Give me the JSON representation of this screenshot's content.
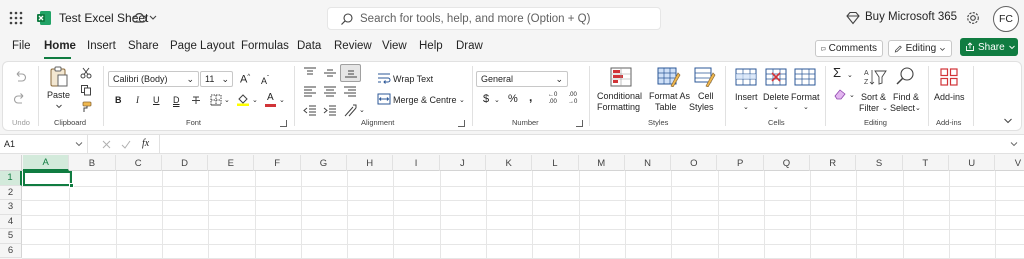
{
  "titlebar": {
    "doc_title": "Test Excel Sheet",
    "search_placeholder": "Search for tools, help, and more (Option + Q)",
    "buy": "Buy Microsoft 365",
    "avatar": "FC"
  },
  "tabs": [
    "File",
    "Home",
    "Insert",
    "Share",
    "Page Layout",
    "Formulas",
    "Data",
    "Review",
    "View",
    "Help",
    "Draw"
  ],
  "actions": {
    "comments": "Comments",
    "editing": "Editing",
    "share": "Share"
  },
  "ribbon": {
    "undo_group": "Undo",
    "clipboard": {
      "paste": "Paste",
      "group": "Clipboard"
    },
    "font": {
      "name": "Calibri (Body)",
      "size": "11",
      "group": "Font"
    },
    "alignment": {
      "wrap": "Wrap Text",
      "merge": "Merge & Centre",
      "group": "Alignment"
    },
    "number": {
      "format": "General",
      "group": "Number"
    },
    "styles": {
      "cond1": "Conditional",
      "cond2": "Formatting",
      "fmt1": "Format As",
      "fmt2": "Table",
      "cell1": "Cell",
      "cell2": "Styles",
      "group": "Styles"
    },
    "cells": {
      "insert": "Insert",
      "delete": "Delete",
      "format": "Format",
      "group": "Cells"
    },
    "editing": {
      "sort1": "Sort &",
      "sort2": "Filter",
      "find1": "Find &",
      "find2": "Select",
      "group": "Editing"
    },
    "addins": {
      "label": "Add-ins",
      "group": "Add-ins"
    }
  },
  "formula_bar": {
    "namebox": "A1",
    "fx": "fx"
  },
  "grid": {
    "columns": [
      "A",
      "B",
      "C",
      "D",
      "E",
      "F",
      "G",
      "H",
      "I",
      "J",
      "K",
      "L",
      "M",
      "N",
      "O",
      "P",
      "Q",
      "R",
      "S",
      "T",
      "U",
      "V"
    ],
    "rows": [
      "1",
      "2",
      "3",
      "4",
      "5",
      "6"
    ],
    "selected_cell": "A1"
  },
  "colors": {
    "accent": "#107c41",
    "selection": "#107c41"
  }
}
